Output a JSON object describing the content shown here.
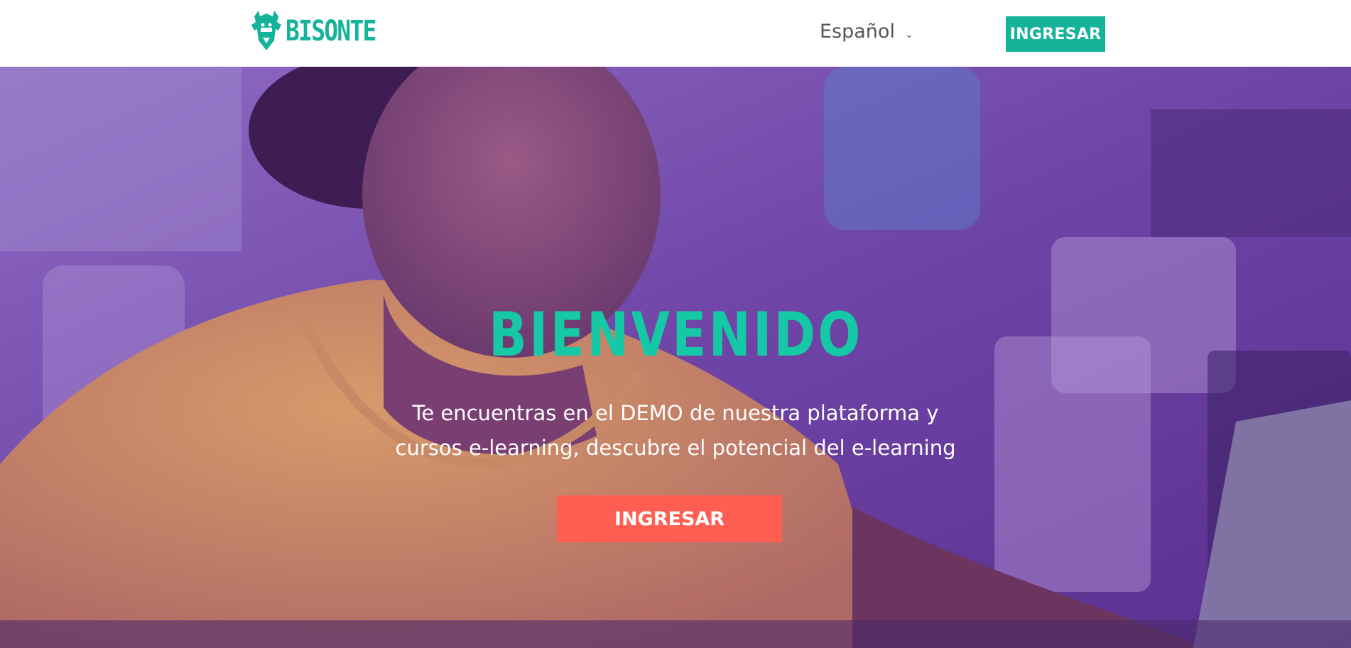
{
  "header": {
    "logo_text": "BISONTE",
    "language": "Español",
    "login_label": "INGRESAR"
  },
  "hero": {
    "title": "BIENVENIDO",
    "subtitle_line1": "Te encuentras en el DEMO de nuestra plataforma y",
    "subtitle_line2": "cursos e-learning, descubre el potencial del e-learning",
    "cta_label": "INGRESAR"
  },
  "colors": {
    "brand_teal": "#16b39b",
    "title_teal": "#16c9a6",
    "cta_coral": "#ff5f52",
    "overlay_purple": "#6b3fa3"
  },
  "icons": {
    "logo": "bison-head-icon",
    "language_dropdown": "chevron-down-icon"
  }
}
